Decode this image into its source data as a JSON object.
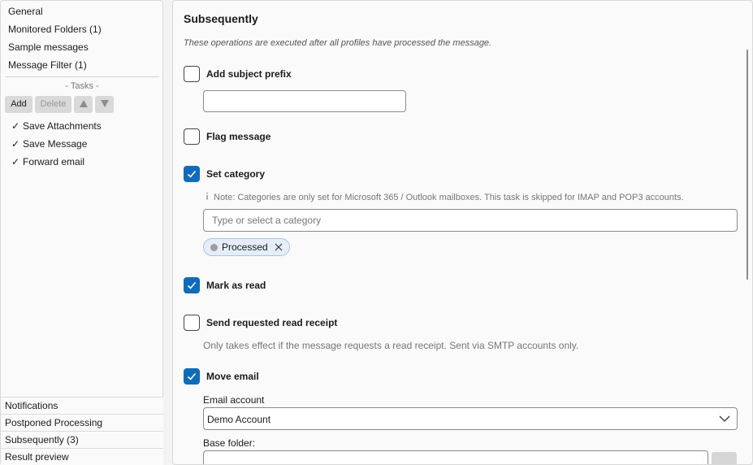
{
  "left_nav": {
    "top_items": [
      {
        "label": "General"
      },
      {
        "label": "Monitored Folders (1)"
      },
      {
        "label": "Sample messages"
      },
      {
        "label": "Message Filter (1)"
      }
    ],
    "tasks_heading": "- Tasks -",
    "toolbar": {
      "add_label": "Add",
      "delete_label": "Delete"
    },
    "tasks": [
      {
        "check": "✓",
        "label": "Save Attachments"
      },
      {
        "check": "✓",
        "label": "Save Message"
      },
      {
        "check": "✓",
        "label": "Forward email"
      }
    ],
    "bottom_items": [
      {
        "label": "Notifications"
      },
      {
        "label": "Postponed Processing"
      },
      {
        "label": "Subsequently (3)"
      },
      {
        "label": "Result preview"
      }
    ]
  },
  "main": {
    "title": "Subsequently",
    "description": "These operations are executed after all profiles have processed the message.",
    "options": {
      "add_subject_prefix": {
        "label": "Add subject prefix",
        "checked": false,
        "value": ""
      },
      "flag_message": {
        "label": "Flag message",
        "checked": false
      },
      "set_category": {
        "label": "Set category",
        "checked": true,
        "note_icon": "info-icon",
        "note": "Note: Categories are only set for Microsoft 365 / Outlook mailboxes. This task is skipped for IMAP and POP3 accounts.",
        "placeholder": "Type or select a category",
        "chips": [
          {
            "label": "Processed",
            "color": "#9e9e9e"
          }
        ]
      },
      "mark_as_read": {
        "label": "Mark as read",
        "checked": true
      },
      "send_read_receipt": {
        "label": "Send requested read receipt",
        "checked": false,
        "hint": "Only takes effect if the message requests a read receipt. Sent via SMTP accounts only."
      },
      "move_email": {
        "label": "Move email",
        "checked": true,
        "email_account_label": "Email account",
        "email_account_value": "Demo Account",
        "base_folder_label": "Base folder:"
      }
    }
  },
  "colors": {
    "accent": "#0f6cbd",
    "chip_bg": "#e4edf8",
    "chip_border": "#a9c4e4"
  }
}
